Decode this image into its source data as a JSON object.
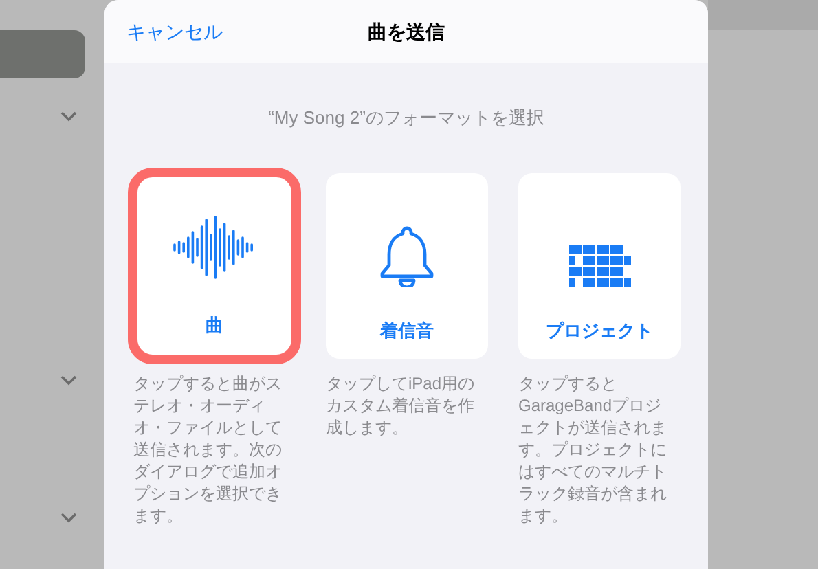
{
  "dialog": {
    "cancel": "キャンセル",
    "title": "曲を送信",
    "prompt": "“My Song 2”のフォーマットを選択",
    "options": [
      {
        "kind": "song",
        "label": "曲",
        "selected": true,
        "description": "タップすると曲がステレオ・オーディオ・ファイルとして送信されます。次のダイアログで追加オプションを選択できます。"
      },
      {
        "kind": "ringtone",
        "label": "着信音",
        "selected": false,
        "description": "タップしてiPad用のカスタム着信音を作成します。"
      },
      {
        "kind": "project",
        "label": "プロジェクト",
        "selected": false,
        "description": "タップするとGarageBandプロジェクトが送信されます。プロジェクトにはすべてのマルチトラック録音が含まれます。"
      }
    ]
  }
}
